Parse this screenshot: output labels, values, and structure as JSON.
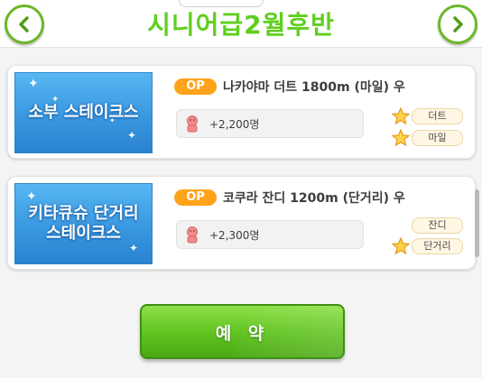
{
  "header": {
    "title": "시니어급2월후반"
  },
  "races": [
    {
      "banner": "소부 스테이크스",
      "badge": "OP",
      "name": "나카야마 더트 1800m (마일) 우",
      "fans": "+2,200명",
      "aptitudes": [
        {
          "label": "더트",
          "starred": true
        },
        {
          "label": "마일",
          "starred": true
        }
      ]
    },
    {
      "banner": "키타큐슈 단거리\n스테이크스",
      "badge": "OP",
      "name": "코쿠라 잔디 1200m (단거리) 우",
      "fans": "+2,300명",
      "aptitudes": [
        {
          "label": "잔디",
          "starred": false
        },
        {
          "label": "단거리",
          "starred": true
        }
      ]
    }
  ],
  "actions": {
    "reserve_label": "예 약"
  },
  "colors": {
    "title": "#5fcf1e",
    "badge": "#ffa31a",
    "banner": "#3a98e0",
    "button": "#5fc21f"
  },
  "icons": {
    "prev": "chevron-left-icon",
    "next": "chevron-right-icon",
    "fans": "fan-person-icon",
    "aptitude": "star-icon"
  }
}
